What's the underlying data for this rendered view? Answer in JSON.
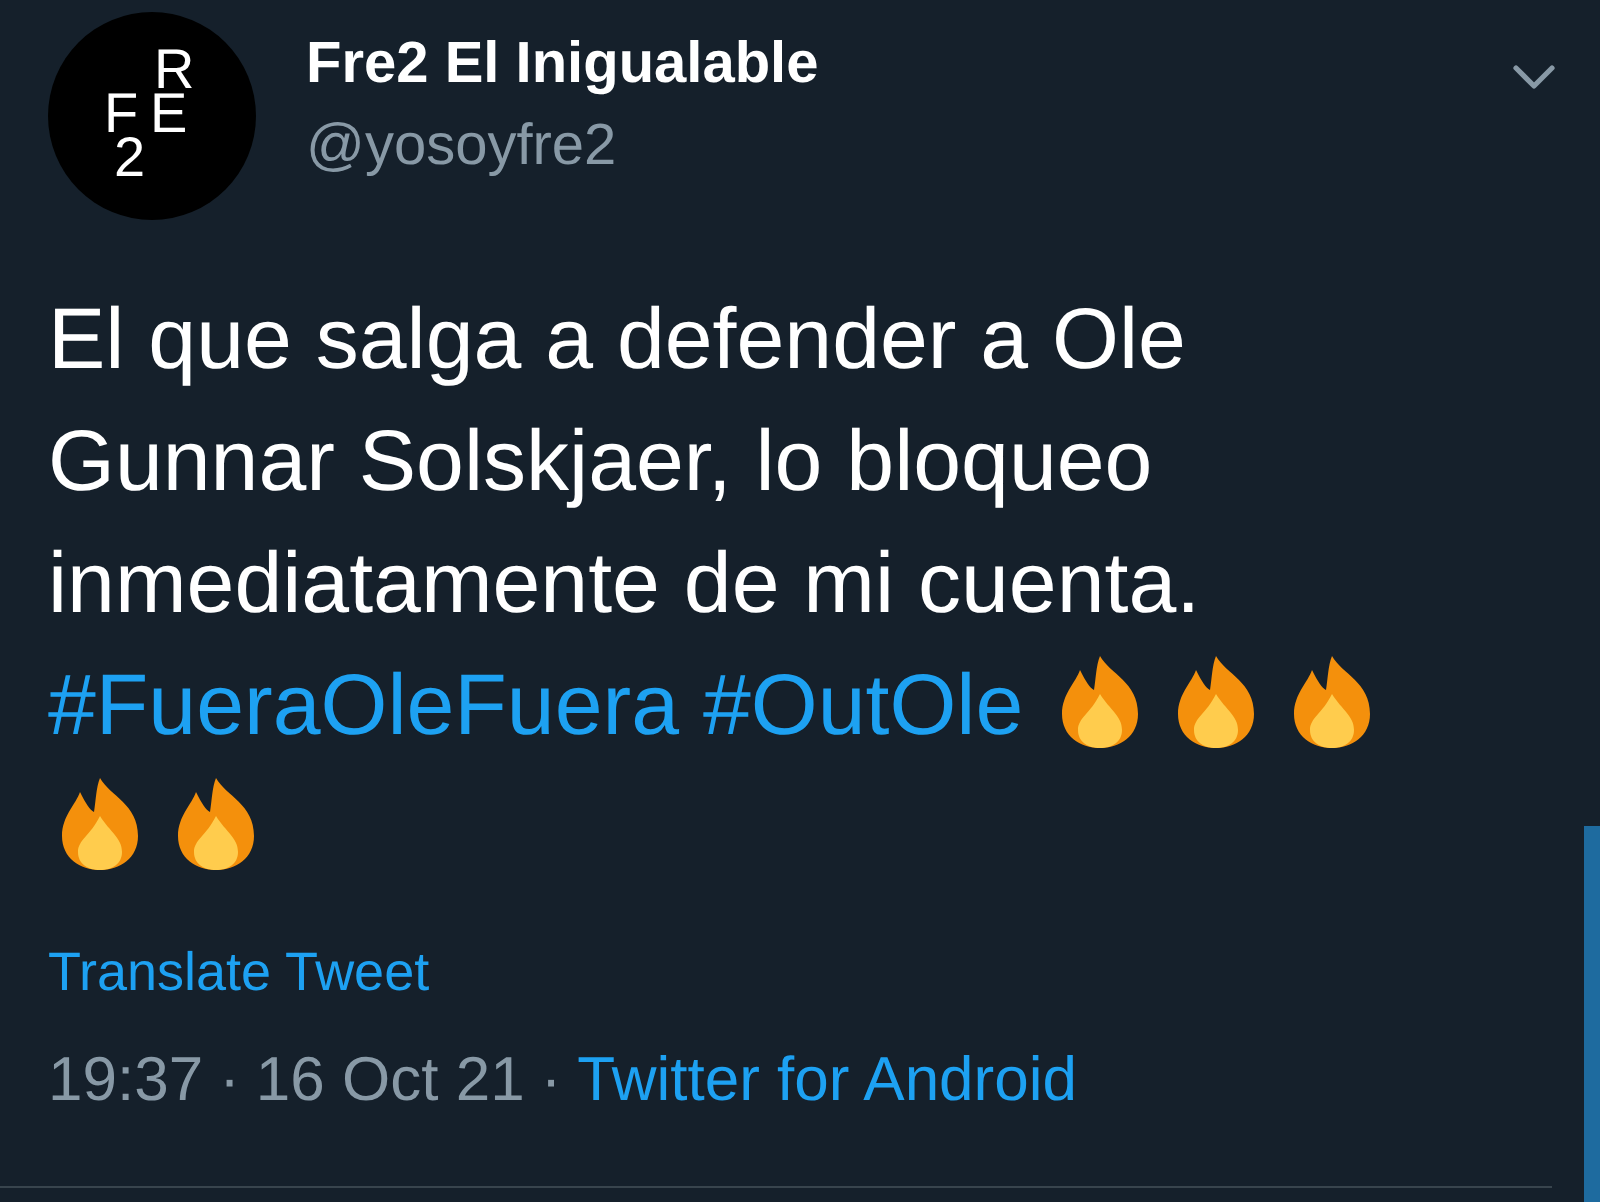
{
  "author": {
    "avatar_letters": [
      "R",
      "F",
      "E",
      "2"
    ],
    "name": "Fre2 El Inigualable",
    "handle": "@yosoyfre2"
  },
  "tweet": {
    "segments": [
      {
        "kind": "text",
        "text": "El que salga a defender a Ole Gunnar Solskjaer, lo bloqueo inmediatamente de mi cuenta. "
      },
      {
        "kind": "hashtag",
        "text": "#FueraOleFuera"
      },
      {
        "kind": "hashtag",
        "text": "#OutOle"
      }
    ]
  },
  "translate_link": "Translate Tweet",
  "meta": {
    "time": "19:37",
    "separator_1": "·",
    "date": "16 Oct 21",
    "separator_2": "·",
    "source": "Twitter for Android"
  }
}
